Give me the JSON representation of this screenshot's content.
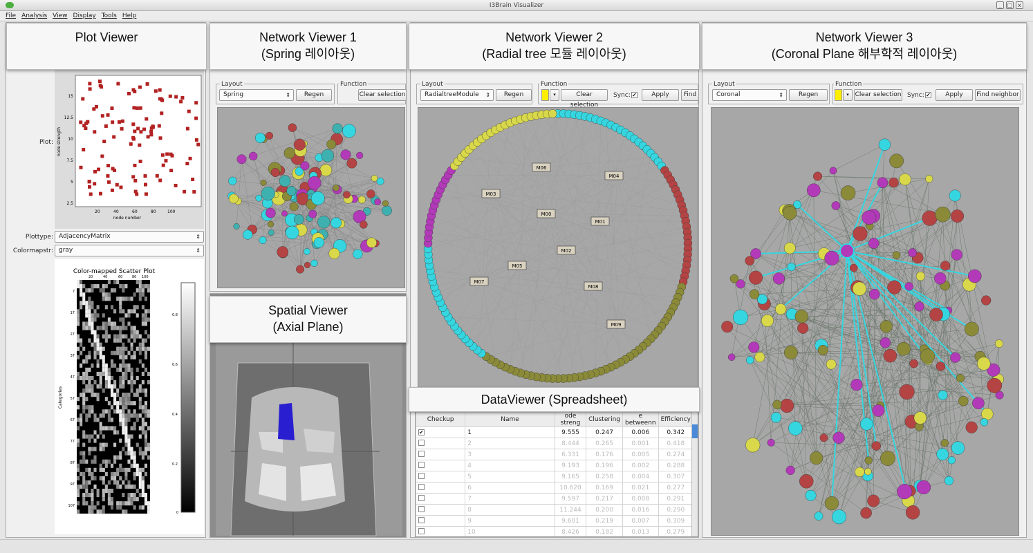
{
  "window": {
    "title": "I3Brain Visualizer",
    "min": "_",
    "max": "□",
    "close": "x"
  },
  "menu": [
    "File",
    "Analysis",
    "View",
    "Display",
    "Tools",
    "Help"
  ],
  "callouts": {
    "plot": "Plot Viewer",
    "net1_a": "Network Viewer 1",
    "net1_b": "(Spring 레이아웃)",
    "net2_a": "Network Viewer 2",
    "net2_b": "(Radial tree 모듈 레이아웃)",
    "net3_a": "Network Viewer 3",
    "net3_b": "(Coronal Plane 해부학적 레이아웃)",
    "spatial_a": "Spatial Viewer",
    "spatial_b": "(Axial Plane)",
    "data": "DataViewer (Spreadsheet)"
  },
  "plot_viewer": {
    "plot_label": "Plot:",
    "plottype_label": "Plottype:",
    "plottype_value": "AdjacencyMatrix",
    "colormap_label": "Colormapstr:",
    "colormap_value": "gray",
    "scatter": {
      "xlabel": "node number",
      "ylabel": "node strength",
      "xticks": [
        "20",
        "40",
        "60",
        "80",
        "100"
      ],
      "yticks": [
        "15",
        "12.5",
        "10",
        "7.5",
        "5",
        "2.5"
      ]
    },
    "matrix": {
      "title": "Color-mapped Scatter Plot",
      "ylabel": "Categories",
      "xticks": [
        "20",
        "40",
        "60",
        "80",
        "100"
      ],
      "yticks": [
        "7",
        "17",
        "27",
        "37",
        "47",
        "57",
        "67",
        "77",
        "87",
        "97",
        "107"
      ],
      "cbar": [
        "0.8",
        "0.6",
        "0.4",
        "0.2",
        "0"
      ]
    }
  },
  "toolbar": {
    "layout_label": "Layout",
    "function_label": "Function",
    "regen": "Regen",
    "clear": "Clear selection",
    "sync": "Sync:",
    "apply": "Apply",
    "find": "Find neighbor",
    "find_short": "Find r"
  },
  "net1": {
    "layout": "Spring"
  },
  "net2": {
    "layout": "RadialtreeModule",
    "modules": [
      "M06",
      "M03",
      "M00",
      "M01",
      "M05",
      "M02",
      "M04",
      "M07",
      "M08",
      "M09"
    ]
  },
  "net3": {
    "layout": "Coronal"
  },
  "colors": {
    "cyan": "#35d6e0",
    "magenta": "#b23ab8",
    "olive": "#8a8a38",
    "yellow": "#d8d84a",
    "red": "#b44444",
    "teal": "#3fb0b0"
  },
  "sheet": {
    "headers": [
      "Checkup",
      "Name",
      "ode streng",
      "Clustering",
      "e betweenn",
      "Efficiency"
    ],
    "rows": [
      [
        "✔",
        "1",
        "9.555",
        "0.247",
        "0.006",
        "0.342"
      ],
      [
        "",
        "2",
        "8.444",
        "0.265",
        "0.001",
        "0.418"
      ],
      [
        "",
        "3",
        "6.331",
        "0.176",
        "0.005",
        "0.274"
      ],
      [
        "",
        "4",
        "9.193",
        "0.196",
        "0.002",
        "0.288"
      ],
      [
        "",
        "5",
        "9.165",
        "0.258",
        "0.004",
        "0.307"
      ],
      [
        "",
        "6",
        "10.620",
        "0.169",
        "0.021",
        "0.277"
      ],
      [
        "",
        "7",
        "9.597",
        "0.217",
        "0.008",
        "0.291"
      ],
      [
        "",
        "8",
        "11.244",
        "0.200",
        "0.016",
        "0.290"
      ],
      [
        "",
        "9",
        "9.601",
        "0.219",
        "0.007",
        "0.309"
      ],
      [
        "",
        "10",
        "8.426",
        "0.182",
        "0.013",
        "0.279"
      ]
    ]
  }
}
